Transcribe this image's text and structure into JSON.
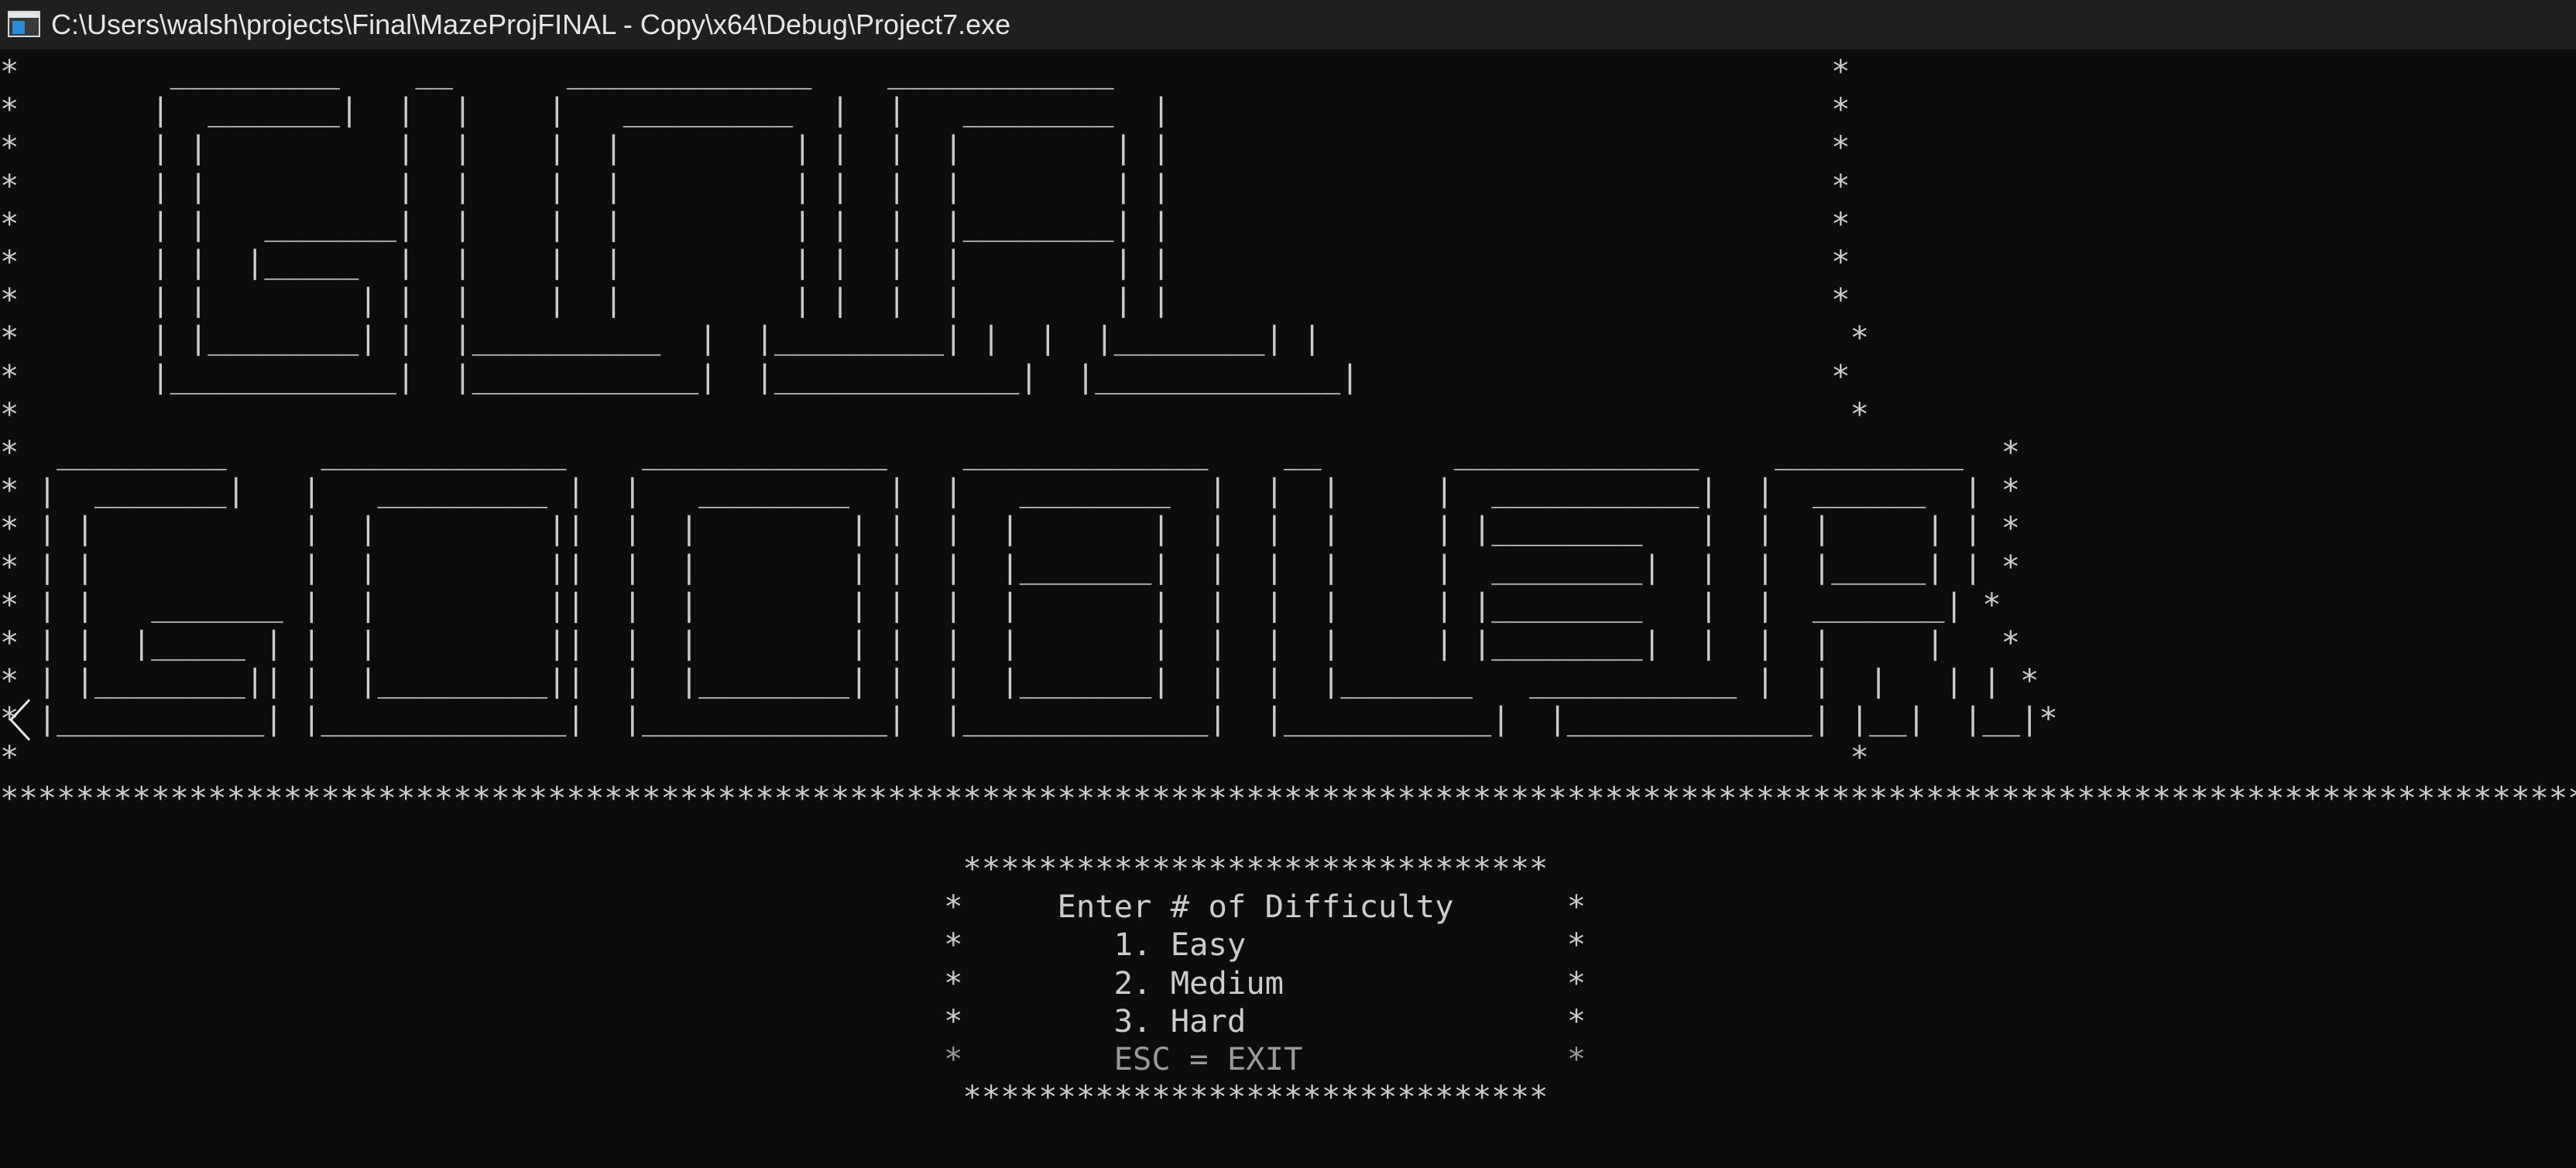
{
  "window": {
    "title": "C:\\Users\\walsh\\projects\\Final\\MazeProjFINAL - Copy\\x64\\Debug\\Project7.exe",
    "icon": "console-app-icon"
  },
  "console": {
    "banner": "*        _________    __      _____________    ____________                                      *\n*       |  _______|  |  |    |   _________  |  |   ________  |                                   *\n*       | |          |  |    |  |         | |  |  |        | |                                   *\n*       | |          |  |    |  |         | |  |  |        | |                                   *\n*       | |   _______|  |    |  |         | |  |  |________| |                                   *\n*       | |  |_____  |  |    |  |         | |  |  |        | |                                   *\n*       | |        | |  |    |  |         | |  |  |        | |                                   *\n*       | |________| |  |__________  |  |_________| |  |  |________| |                            *\n*       |____________|  |____________|  |_____________|  |_____________|                         *\n*                                                                                                 *\n*  _________     _____________    _____________    _____________    __       _____________    __________  *\n* |  _______|   |   _________ |  |   ________  |  |   ________  |  |  |     |  ___________|  |  ______  | *\n* | |           |  |         ||  |  |        | |  |  |       |  |  |  |     | |________   |  |  |     | | *\n* | |           |  |         ||  |  |        | |  |  |_______|  |  |  |     |  ________|  |  |  |_____| | *\n* | |   _______ |  |         ||  |  |        | |  |  |       |  |  |  |     | |________   |  |  _______| *\n* | |  |_____ | |  |         ||  |  |        | |  |  |       |  |  |  |     | |________|  |  |  |     |   *\n* | |________|| |  |_________||  |  |________| |  |  |_______|  |  |  |_______   ___________ |  |  |   | | *\n* |___________| |_____________|  |_____________|  |_____________|  |___________|  |_____________| |__|  |__|*\n*                                                                                                 *",
    "rule": "***********************************************************************************************************************************************",
    "menu": {
      "top_border": "                                                   *******************************",
      "heading": "                                                  *     Enter # of Difficulty      *",
      "opt1": "                                                  *        1. Easy                 *",
      "opt2": "                                                  *        2. Medium               *",
      "opt3": "                                                  *        3. Hard                 *",
      "exit": "                                                  *        ESC = EXIT              *",
      "bottom_border": "                                                   *******************************"
    }
  },
  "colors": {
    "background": "#0c0c0c",
    "text": "#cccccc",
    "titlebar": "#1f1f1f"
  }
}
